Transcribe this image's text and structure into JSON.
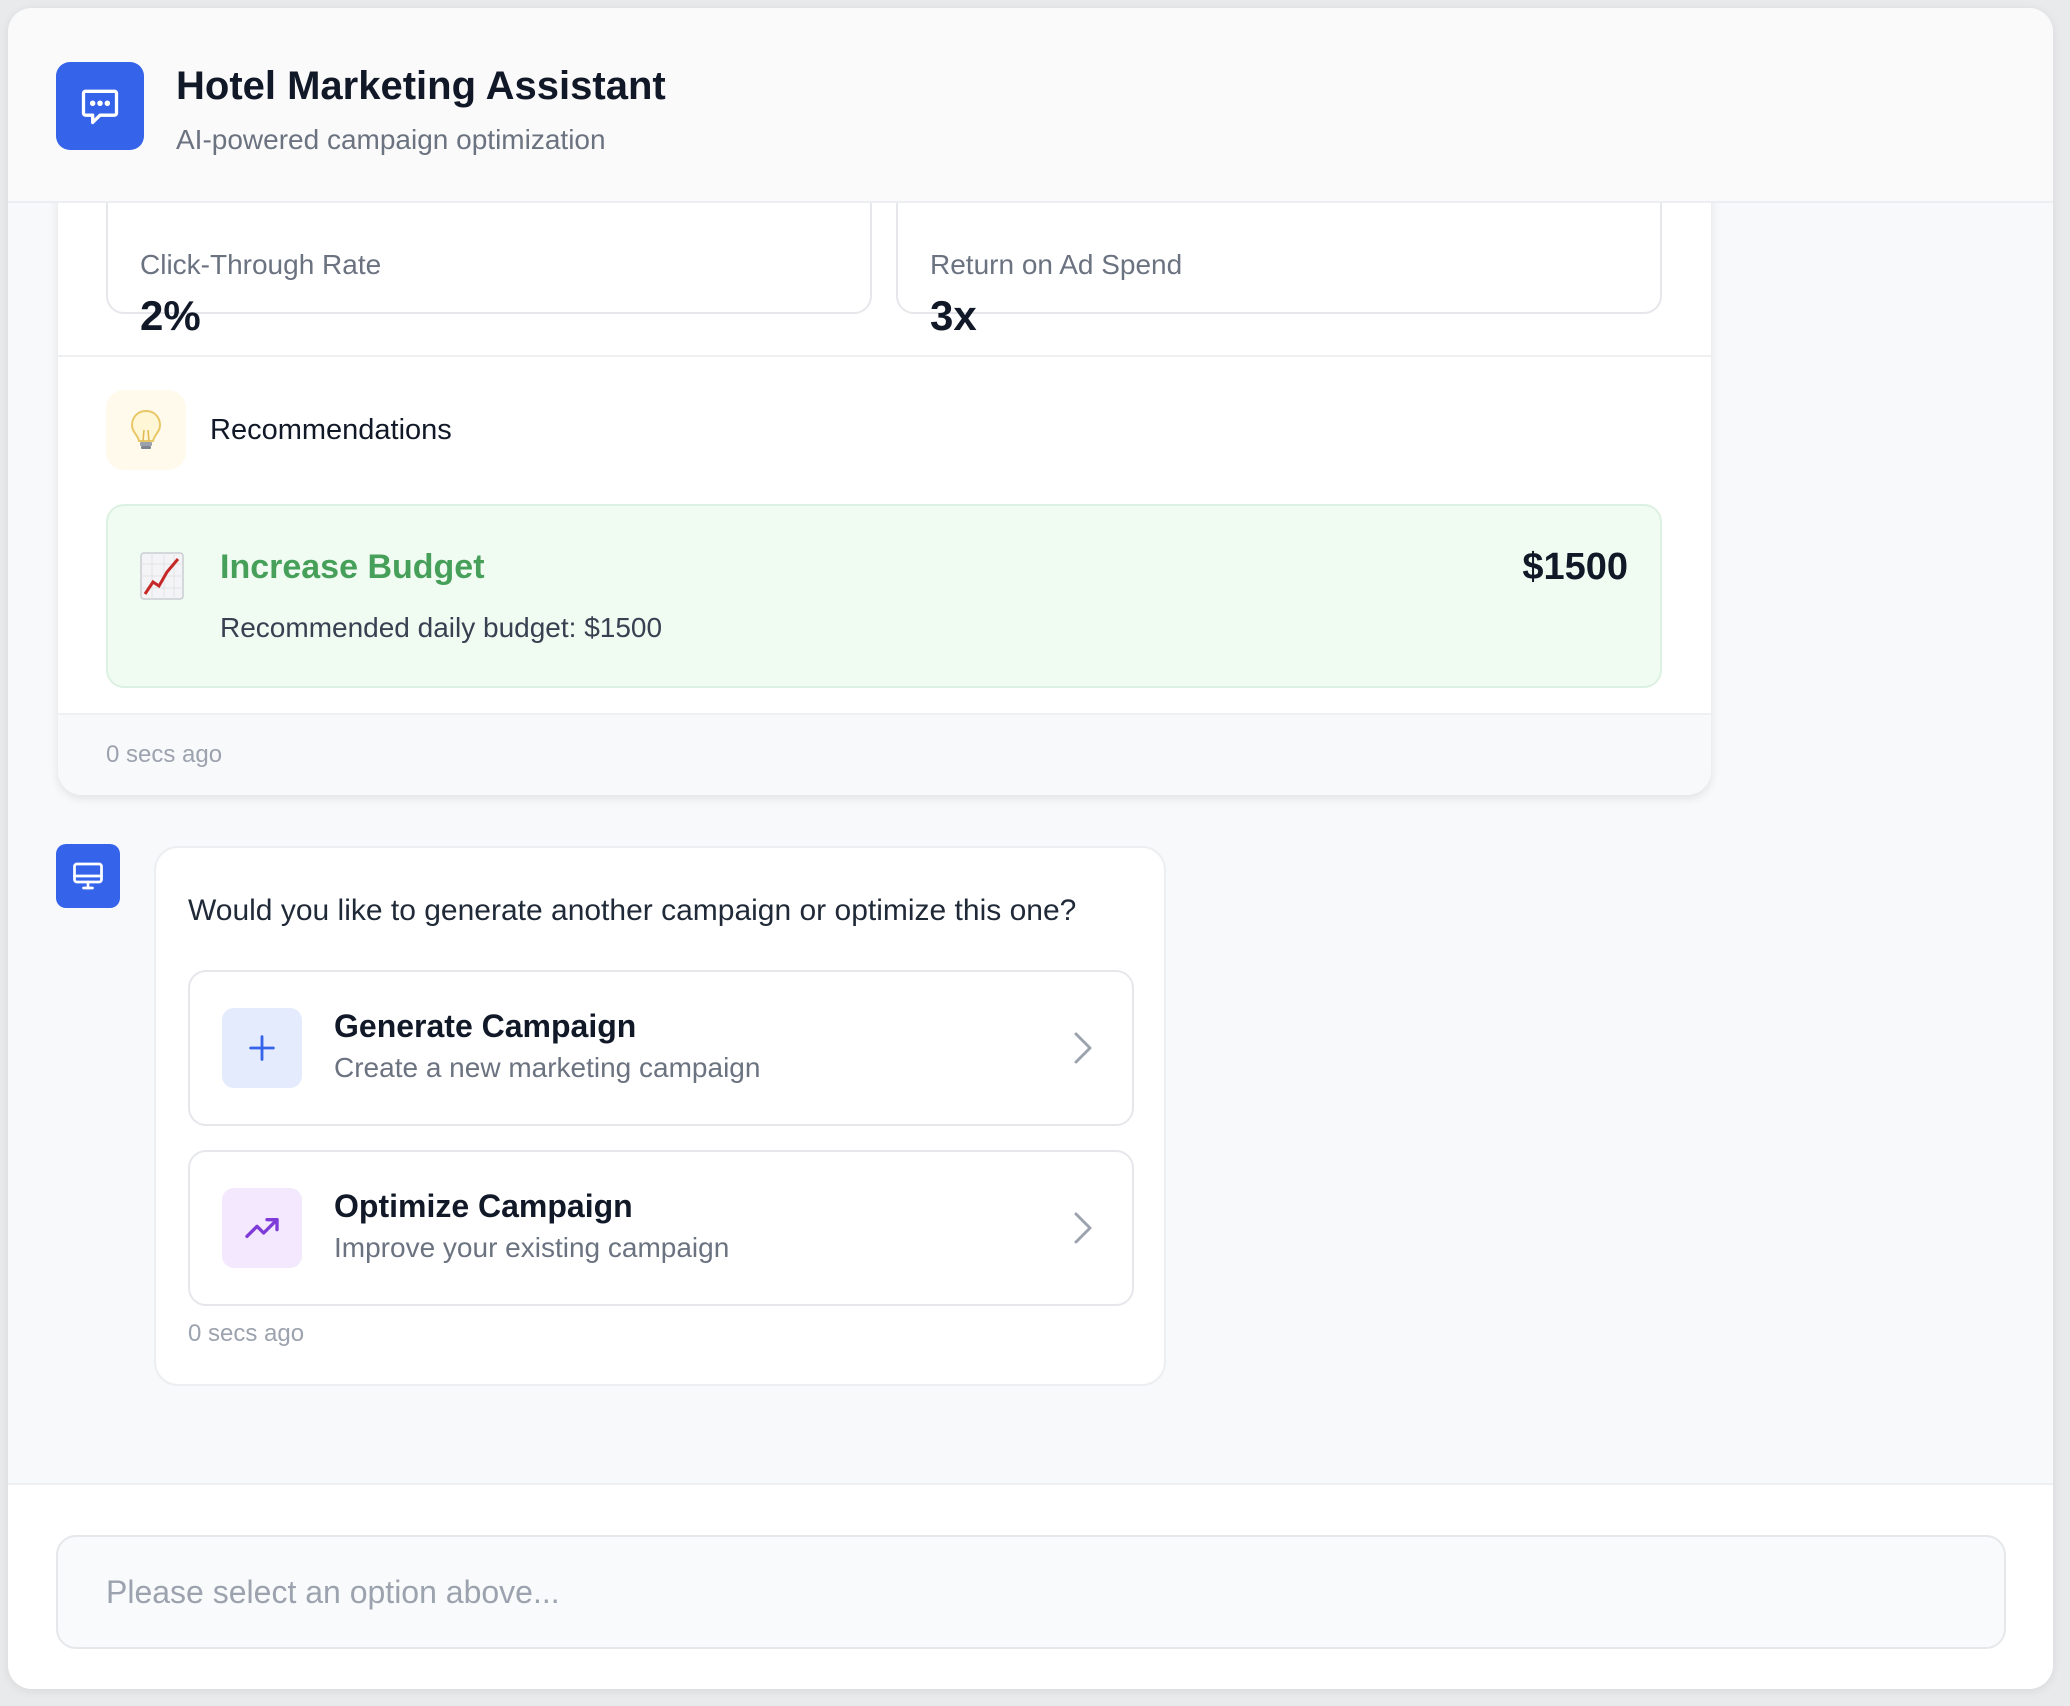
{
  "header": {
    "title": "Hotel Marketing Assistant",
    "subtitle": "AI-powered campaign optimization"
  },
  "analytics_card": {
    "metrics": [
      {
        "label": "Click-Through Rate",
        "value": "2%"
      },
      {
        "label": "Return on Ad Spend",
        "value": "3x"
      }
    ],
    "recommendations_heading": "Recommendations",
    "recommendation": {
      "title": "Increase Budget",
      "value": "$1500",
      "description": "Recommended daily budget: $1500"
    },
    "timestamp": "0 secs ago"
  },
  "bot_message": {
    "question": "Would you like to generate another campaign or optimize this one?",
    "options": [
      {
        "title": "Generate Campaign",
        "description": "Create a new marketing campaign",
        "icon": "plus-icon"
      },
      {
        "title": "Optimize Campaign",
        "description": "Improve your existing campaign",
        "icon": "trending-up-icon"
      }
    ],
    "timestamp": "0 secs ago"
  },
  "input": {
    "placeholder": "Please select an option above..."
  },
  "colors": {
    "accent": "#3563e9",
    "success": "#46a05a",
    "purple": "#7e3bd8"
  }
}
